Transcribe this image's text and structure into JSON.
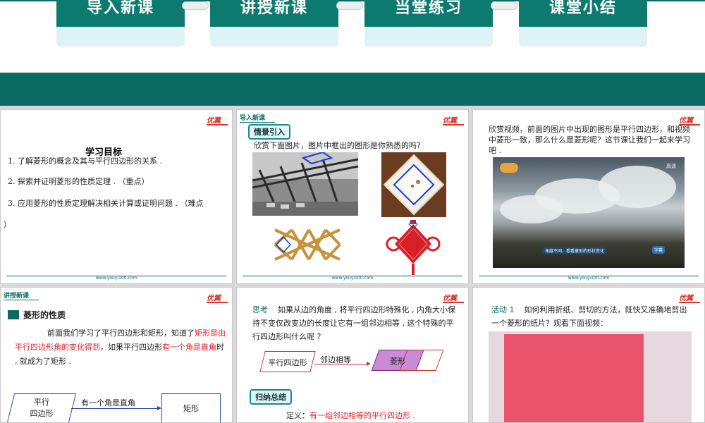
{
  "nav": {
    "items": [
      "导入新课",
      "讲授新课",
      "当堂练习",
      "课堂小结"
    ],
    "colors": {
      "header": "#0d7a70",
      "band": "#0a6b62",
      "card": "#dff3f6"
    }
  },
  "common": {
    "logo": "优翼",
    "footer_url": "www.youyi100.com"
  },
  "slide1": {
    "title": "学习目标",
    "items": [
      "1. 了解菱形的概念及其与平行四边形的关系 .",
      "2. 探索并证明菱形的性质定理 . （重点）",
      "3. 应用菱形的性质定理解决相关计算或证明问题 . （难点",
      "）"
    ]
  },
  "slide2": {
    "section": "导入新课",
    "label": "情景引入",
    "question": "欣赏下面图片，图片中框出的图形是你熟悉的吗?"
  },
  "slide3": {
    "text": "欣赏视频，前面的图片中出现的图形是平行四边形，和视频中菱形一致，那么什么是菱形呢？这节课让我们一起来学习吧 .",
    "video_hd": "高清",
    "video_caption": "角度不同，看看菱形的形状变化",
    "video_cc": "字幕"
  },
  "slide4": {
    "section": "讲授新课",
    "subtitle": "菱形的性质",
    "p1": "前面我们学习了平行四边形和矩形，知道了",
    "p1_red": "矩形是由平行四边形角的变化得到",
    "p2": "，如果平行四边形",
    "p2_red": "有一个角是直角",
    "p3": "时 , 就成为了矩形 .",
    "shape_left": "平行\n四边形",
    "arrow_label": "有一个角是直角",
    "shape_right": "矩形"
  },
  "slide5": {
    "think_label": "思考",
    "think_text": "如果从边的角度 , 将平行四边形特殊化 , 内角大小保持不变仅改变边的长度让它有一组邻边相等 , 这个特殊的平行四边形叫什么呢 ?",
    "shape_left": "平行四边形",
    "arrow_label": "邻边相等",
    "shape_right": "菱形",
    "summary_label": "归纳总结",
    "def_label": "定义：",
    "def_text": "有一组邻边相等的平行四边形 ."
  },
  "slide6": {
    "activity_label": "活动 1",
    "activity_text": "如何利用折纸、剪切的方法，既快又准确地剪出一个菱形的纸片？观看下面视频："
  }
}
